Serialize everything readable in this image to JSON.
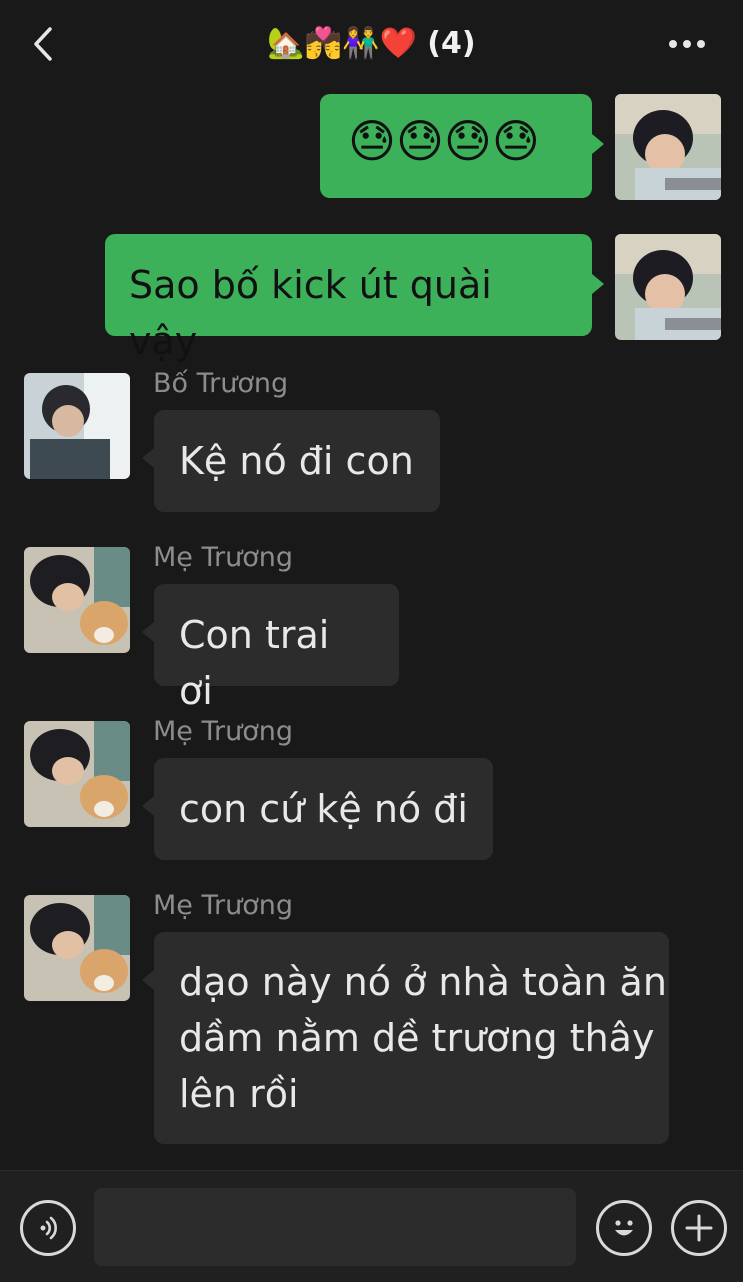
{
  "header": {
    "back_icon": "chevron-left-icon",
    "title_emojis": "🏡💏👫❤️",
    "member_count": "(4)",
    "more_icon": "more-horizontal-icon"
  },
  "messages": [
    {
      "direction": "outgoing",
      "content": "😓😓😓😓"
    },
    {
      "direction": "outgoing",
      "content": "Sao bố kick út quài vậy"
    },
    {
      "direction": "incoming",
      "sender": "Bố Trương",
      "content": "Kệ nó đi con"
    },
    {
      "direction": "incoming",
      "sender": "Mẹ Trương",
      "content": "Con trai ơi"
    },
    {
      "direction": "incoming",
      "sender": "Mẹ Trương",
      "content": "con cứ kệ nó đi"
    },
    {
      "direction": "incoming",
      "sender": "Mẹ Trương",
      "content_lines": [
        "dạo này nó ở nhà toàn ăn",
        "dầm nằm dề trương thây",
        "lên rồi"
      ]
    }
  ],
  "input_bar": {
    "voice_icon": "voice-icon",
    "text_value": "",
    "emoji_icon": "emoji-icon",
    "plus_icon": "plus-icon"
  },
  "colors": {
    "background": "#191919",
    "outgoing_bubble": "#3cb159",
    "incoming_bubble": "#2c2c2c",
    "sender_name": "#8c8c8c"
  }
}
